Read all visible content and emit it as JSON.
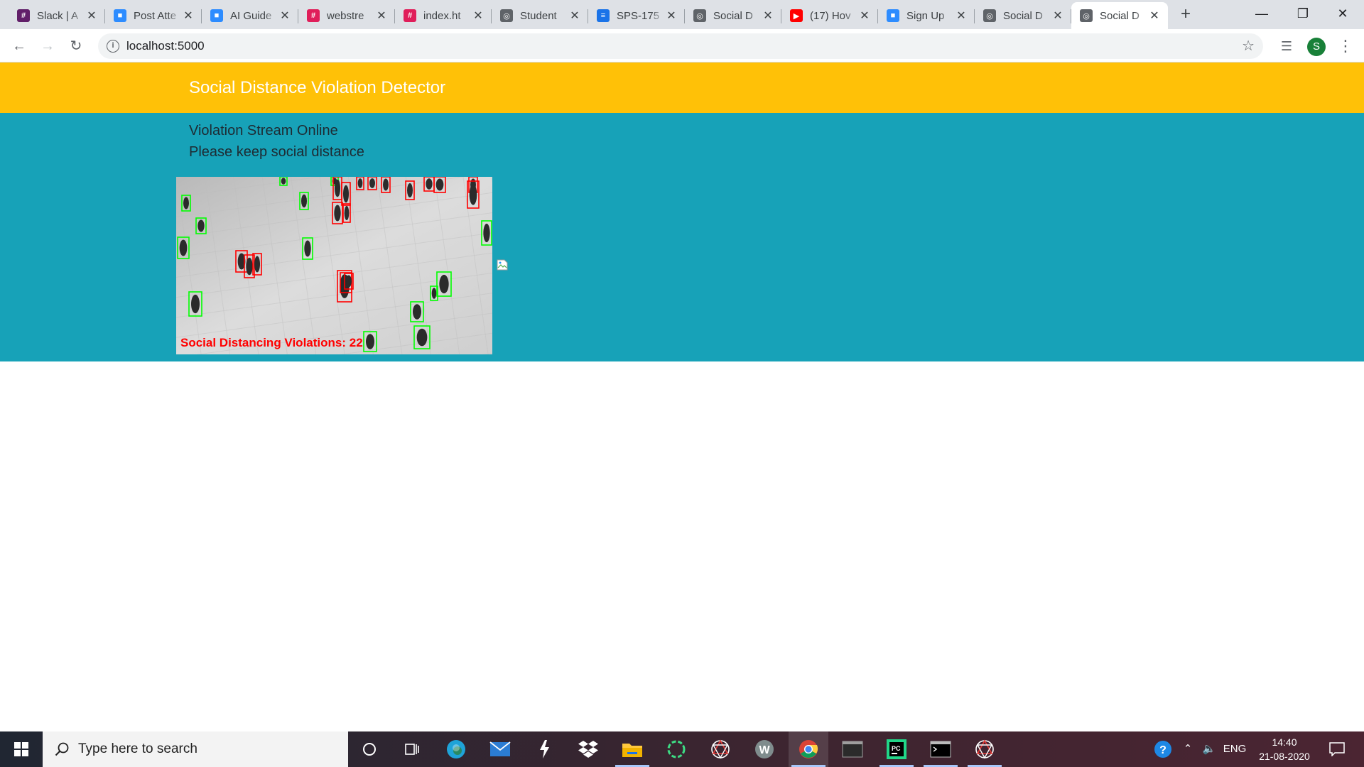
{
  "browser": {
    "tabs": [
      {
        "title": "Slack | A",
        "icon": "slack-icon",
        "color": "#611f69"
      },
      {
        "title": "Post Atte",
        "icon": "zoom-icon",
        "color": "#2d8cff"
      },
      {
        "title": "AI Guide",
        "icon": "zoom-icon",
        "color": "#2d8cff"
      },
      {
        "title": "webstre",
        "icon": "slack-icon",
        "color": "#e01e5a"
      },
      {
        "title": "index.ht",
        "icon": "slack-icon",
        "color": "#e01e5a"
      },
      {
        "title": "Student",
        "icon": "globe-icon",
        "color": "#5f6368"
      },
      {
        "title": "SPS-175",
        "icon": "form-icon",
        "color": "#1a73e8"
      },
      {
        "title": "Social D",
        "icon": "globe-icon",
        "color": "#5f6368"
      },
      {
        "title": "(17) Hov",
        "icon": "youtube-icon",
        "color": "#ff0000"
      },
      {
        "title": "Sign Up",
        "icon": "zoom-icon",
        "color": "#2d8cff"
      },
      {
        "title": "Social D",
        "icon": "globe-icon",
        "color": "#5f6368"
      },
      {
        "title": "Social D",
        "icon": "globe-icon",
        "color": "#5f6368",
        "active": true
      }
    ],
    "url": "localhost:5000",
    "profile_initial": "S"
  },
  "page": {
    "brand": "Social Distance Violation Detector",
    "status_line1": "Violation Stream Online",
    "status_line2": "Please keep social distance",
    "video_overlay_text": "Social Distancing Violations: 22",
    "colors": {
      "navbar": "#ffc107",
      "stream_bg": "#17a2b8",
      "violation": "#ff0000",
      "safe": "#00ff00"
    }
  },
  "taskbar": {
    "search_placeholder": "Type here to search",
    "language": "ENG",
    "time": "14:40",
    "date": "21-08-2020"
  }
}
